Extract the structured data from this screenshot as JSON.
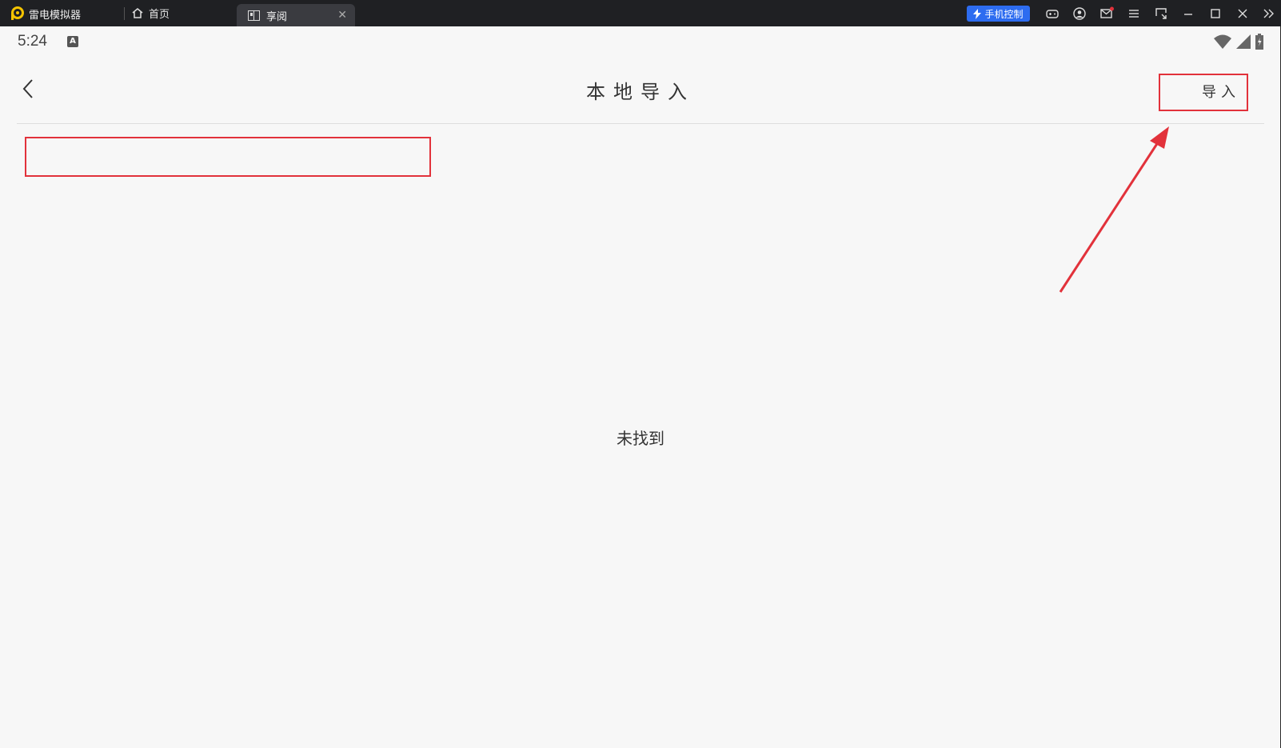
{
  "titlebar": {
    "app_name": "雷电模拟器",
    "tabs": [
      {
        "label": "首页",
        "icon": "home-icon"
      },
      {
        "label": "享阅",
        "icon": "book-icon",
        "active": true
      }
    ],
    "phone_control_label": "手机控制",
    "icons": [
      "gamepad-icon",
      "account-icon",
      "mail-icon",
      "menu-icon",
      "screen-icon",
      "minimize-icon",
      "maximize-icon",
      "close-icon",
      "expand-icon"
    ],
    "accent": "#2d6cf0"
  },
  "statusbar": {
    "time": "5:24",
    "ime_glyph": "A"
  },
  "page": {
    "title": "本地导入",
    "import_label": "导入",
    "empty_text": "未找到",
    "highlight_color": "#e2323b"
  }
}
